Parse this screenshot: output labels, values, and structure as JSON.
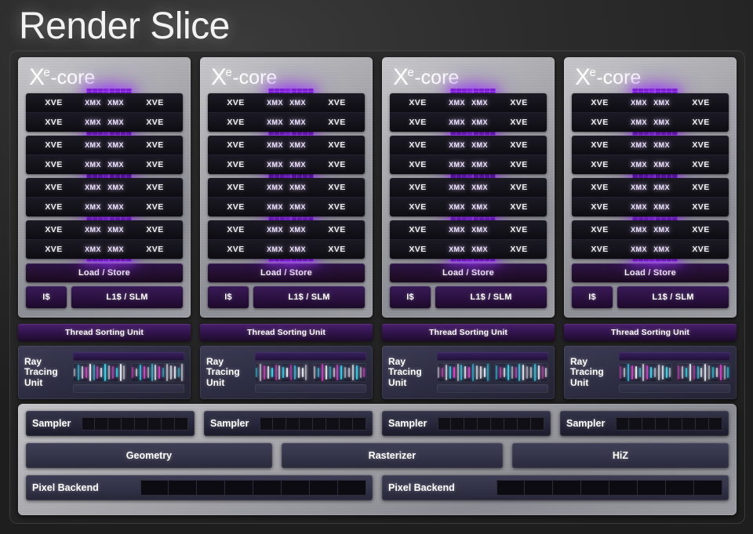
{
  "page": {
    "title": "Render Slice"
  },
  "xe_core": {
    "logo_x": "X",
    "logo_superscript": "e",
    "logo_suffix": "-core",
    "xve_label": "XVE",
    "xmx_label": "XMX",
    "load_store_label": "Load / Store",
    "instruction_cache_label": "I$",
    "l1_slm_label": "L1$ / SLM",
    "groups": 4,
    "rows_per_group": 2,
    "count": 4
  },
  "thread_sorting": {
    "label": "Thread Sorting Unit",
    "count": 4
  },
  "ray_tracing": {
    "label": "Ray Tracing Unit",
    "label_line1": "Ray",
    "label_line2": "Tracing",
    "label_line3": "Unit",
    "count": 4,
    "panels_per_unit": 2
  },
  "fixed_function": {
    "sampler_label": "Sampler",
    "sampler_count": 4,
    "sampler_cells": 8,
    "pixel_backend_label": "Pixel Backend",
    "pixel_backend_count": 2,
    "pixel_backend_cells": 8,
    "mid_bars": [
      {
        "label": "Geometry"
      },
      {
        "label": "Rasterizer"
      },
      {
        "label": "HiZ"
      }
    ]
  },
  "colors": {
    "background": "#1e1e1e",
    "title_text": "#f2f2f2",
    "xe_core_panel": "#a9a9af",
    "xmx_accent": "#7a1fd0",
    "thread_sorting": "#4a1f70",
    "cache_violet": "#3a1a58",
    "fixed_function_panel": "#a6a6ac",
    "ff_bar": "#3e3e56",
    "rt_tick_cyan": "#2fd8f0",
    "rt_tick_magenta": "#e040c8",
    "rt_tick_white": "#e8e8f2"
  }
}
